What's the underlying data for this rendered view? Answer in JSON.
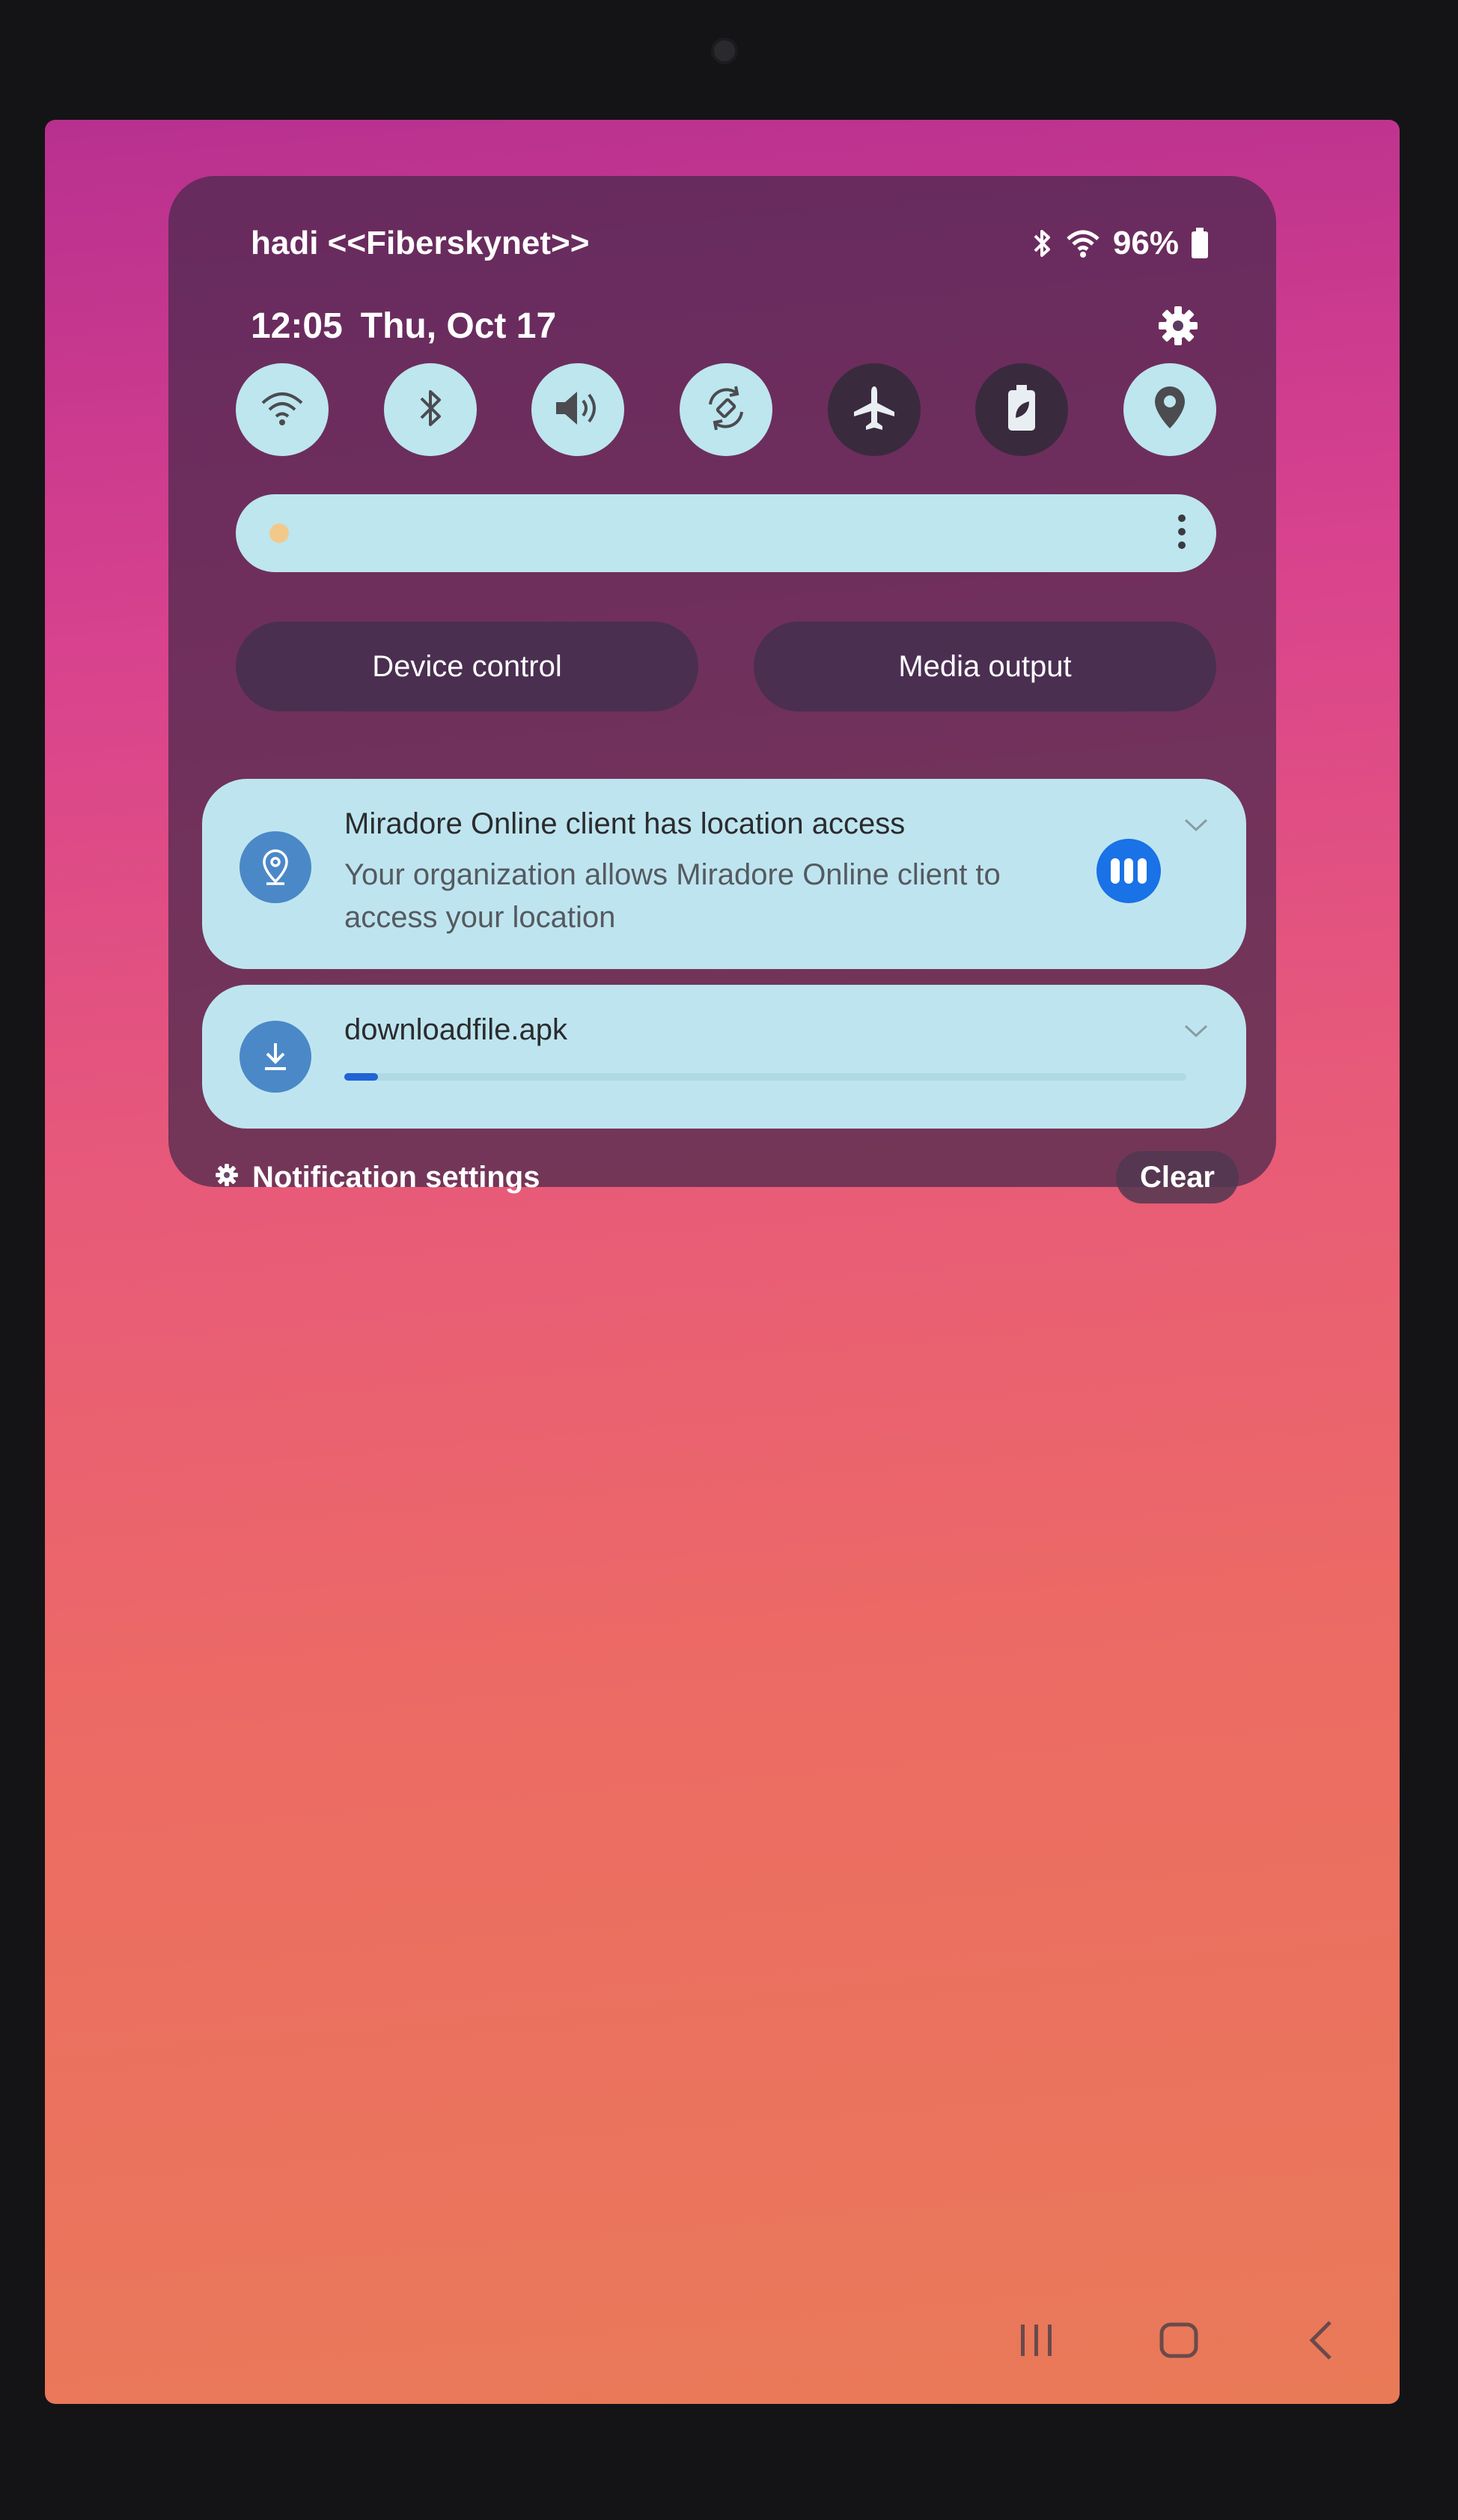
{
  "status_bar": {
    "carrier": "hadi <<Fiberskynet>>",
    "battery": "96%",
    "icons": [
      "bluetooth-icon",
      "wifi-icon",
      "battery-icon"
    ]
  },
  "header": {
    "time": "12:05",
    "date": "Thu, Oct 17",
    "settings_icon": "gear-icon"
  },
  "quick_toggles": [
    {
      "name": "wifi",
      "icon": "wifi-icon",
      "state": "on"
    },
    {
      "name": "bluetooth",
      "icon": "bluetooth-icon",
      "state": "on"
    },
    {
      "name": "sound",
      "icon": "speaker-icon",
      "state": "on"
    },
    {
      "name": "auto-rotate",
      "icon": "rotate-icon",
      "state": "on"
    },
    {
      "name": "airplane-mode",
      "icon": "airplane-icon",
      "state": "off"
    },
    {
      "name": "power-saving",
      "icon": "battery-saver-icon",
      "state": "off"
    },
    {
      "name": "location",
      "icon": "location-pin-icon",
      "state": "on"
    }
  ],
  "brightness": {
    "icon": "sun-icon",
    "more_icon": "more-vertical-icon"
  },
  "quick_buttons": {
    "device_control": "Device control",
    "media_output": "Media output"
  },
  "notifications": [
    {
      "title": "Miradore Online client has location access",
      "body": "Your organization allows Miradore Online client to access your location",
      "icon": "location-pin-icon",
      "action_icon": "app-menu-icon"
    },
    {
      "title": "downloadfile.apk",
      "icon": "download-icon",
      "progress": 0.04
    }
  ],
  "footer": {
    "notification_settings": "Notification settings",
    "clear": "Clear"
  },
  "nav_bar": [
    "recents-icon",
    "home-icon",
    "back-icon"
  ],
  "colors": {
    "toggle_on": "#bde6ee",
    "toggle_off": "#3a2a3e",
    "notification_bg": "#bee5ef",
    "accent_blue": "#1972e6",
    "progress": "#1f63d6"
  }
}
